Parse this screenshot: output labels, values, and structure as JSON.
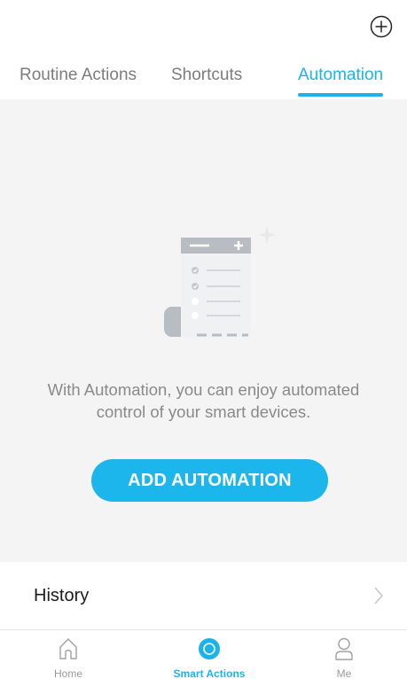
{
  "header": {
    "add_icon": "plus-circle-icon"
  },
  "tabs": [
    {
      "label": "Routine Actions",
      "active": false
    },
    {
      "label": "Shortcuts",
      "active": false
    },
    {
      "label": "Automation",
      "active": true
    }
  ],
  "main": {
    "illustration_icon": "checklist-scroll-illustration",
    "empty_text_line1": "With Automation, you can enjoy automated",
    "empty_text_line2": "control of your smart devices.",
    "cta_label": "ADD AUTOMATION"
  },
  "history": {
    "label": "History",
    "chevron_icon": "chevron-right-icon"
  },
  "tabbar": [
    {
      "label": "Home",
      "icon": "home-icon",
      "active": false
    },
    {
      "label": "Smart Actions",
      "icon": "smart-actions-icon",
      "active": true
    },
    {
      "label": "Me",
      "icon": "person-icon",
      "active": false
    }
  ],
  "colors": {
    "accent": "#1bb4e8",
    "background": "#f4f4f4",
    "text_muted": "#8a8a8a"
  }
}
